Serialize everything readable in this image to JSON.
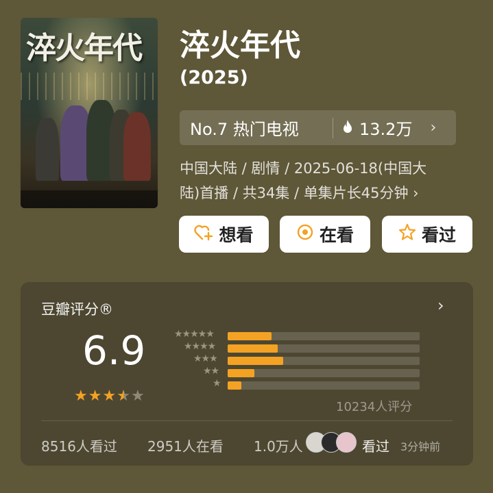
{
  "poster": {
    "title_text": "淬火年代"
  },
  "title": "淬火年代",
  "year": "(2025)",
  "rank": {
    "label": "No.7 热门电视",
    "heat": "13.2万"
  },
  "meta": {
    "line1": "中国大陆 / 剧情 / 2025-06-18(中国大",
    "line2": "陆)首播 / 共34集 / 单集片长45分钟 ›"
  },
  "actions": {
    "want": "想看",
    "watching": "在看",
    "watched": "看过"
  },
  "rating": {
    "label": "豆瓣评分®",
    "score": "6.9",
    "stars": 3.5,
    "count_text": "10234人评分",
    "distribution": [
      {
        "stars": 5,
        "fraction": 0.23
      },
      {
        "stars": 4,
        "fraction": 0.26
      },
      {
        "stars": 3,
        "fraction": 0.29
      },
      {
        "stars": 2,
        "fraction": 0.14
      },
      {
        "stars": 1,
        "fraction": 0.07
      }
    ]
  },
  "stats": {
    "watched": "8516人看过",
    "watching": "2951人在看",
    "want": "1.0万人",
    "friends_action": "看过",
    "time": "3分钟前"
  },
  "colors": {
    "accent": "#f4a223",
    "background": "#5e5738",
    "card": "#4d4731"
  }
}
